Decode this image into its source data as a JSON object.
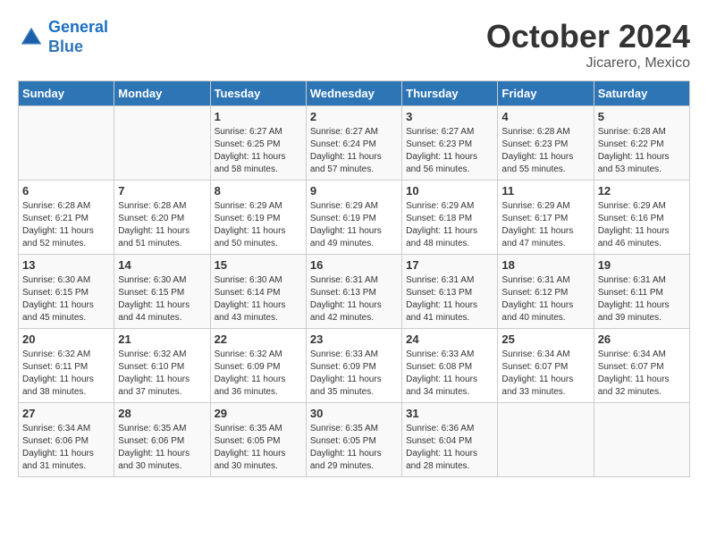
{
  "logo": {
    "line1": "General",
    "line2": "Blue"
  },
  "title": "October 2024",
  "subtitle": "Jicarero, Mexico",
  "headers": [
    "Sunday",
    "Monday",
    "Tuesday",
    "Wednesday",
    "Thursday",
    "Friday",
    "Saturday"
  ],
  "weeks": [
    [
      {
        "day": "",
        "info": ""
      },
      {
        "day": "",
        "info": ""
      },
      {
        "day": "1",
        "info": "Sunrise: 6:27 AM\nSunset: 6:25 PM\nDaylight: 11 hours and 58 minutes."
      },
      {
        "day": "2",
        "info": "Sunrise: 6:27 AM\nSunset: 6:24 PM\nDaylight: 11 hours and 57 minutes."
      },
      {
        "day": "3",
        "info": "Sunrise: 6:27 AM\nSunset: 6:23 PM\nDaylight: 11 hours and 56 minutes."
      },
      {
        "day": "4",
        "info": "Sunrise: 6:28 AM\nSunset: 6:23 PM\nDaylight: 11 hours and 55 minutes."
      },
      {
        "day": "5",
        "info": "Sunrise: 6:28 AM\nSunset: 6:22 PM\nDaylight: 11 hours and 53 minutes."
      }
    ],
    [
      {
        "day": "6",
        "info": "Sunrise: 6:28 AM\nSunset: 6:21 PM\nDaylight: 11 hours and 52 minutes."
      },
      {
        "day": "7",
        "info": "Sunrise: 6:28 AM\nSunset: 6:20 PM\nDaylight: 11 hours and 51 minutes."
      },
      {
        "day": "8",
        "info": "Sunrise: 6:29 AM\nSunset: 6:19 PM\nDaylight: 11 hours and 50 minutes."
      },
      {
        "day": "9",
        "info": "Sunrise: 6:29 AM\nSunset: 6:19 PM\nDaylight: 11 hours and 49 minutes."
      },
      {
        "day": "10",
        "info": "Sunrise: 6:29 AM\nSunset: 6:18 PM\nDaylight: 11 hours and 48 minutes."
      },
      {
        "day": "11",
        "info": "Sunrise: 6:29 AM\nSunset: 6:17 PM\nDaylight: 11 hours and 47 minutes."
      },
      {
        "day": "12",
        "info": "Sunrise: 6:29 AM\nSunset: 6:16 PM\nDaylight: 11 hours and 46 minutes."
      }
    ],
    [
      {
        "day": "13",
        "info": "Sunrise: 6:30 AM\nSunset: 6:15 PM\nDaylight: 11 hours and 45 minutes."
      },
      {
        "day": "14",
        "info": "Sunrise: 6:30 AM\nSunset: 6:15 PM\nDaylight: 11 hours and 44 minutes."
      },
      {
        "day": "15",
        "info": "Sunrise: 6:30 AM\nSunset: 6:14 PM\nDaylight: 11 hours and 43 minutes."
      },
      {
        "day": "16",
        "info": "Sunrise: 6:31 AM\nSunset: 6:13 PM\nDaylight: 11 hours and 42 minutes."
      },
      {
        "day": "17",
        "info": "Sunrise: 6:31 AM\nSunset: 6:13 PM\nDaylight: 11 hours and 41 minutes."
      },
      {
        "day": "18",
        "info": "Sunrise: 6:31 AM\nSunset: 6:12 PM\nDaylight: 11 hours and 40 minutes."
      },
      {
        "day": "19",
        "info": "Sunrise: 6:31 AM\nSunset: 6:11 PM\nDaylight: 11 hours and 39 minutes."
      }
    ],
    [
      {
        "day": "20",
        "info": "Sunrise: 6:32 AM\nSunset: 6:11 PM\nDaylight: 11 hours and 38 minutes."
      },
      {
        "day": "21",
        "info": "Sunrise: 6:32 AM\nSunset: 6:10 PM\nDaylight: 11 hours and 37 minutes."
      },
      {
        "day": "22",
        "info": "Sunrise: 6:32 AM\nSunset: 6:09 PM\nDaylight: 11 hours and 36 minutes."
      },
      {
        "day": "23",
        "info": "Sunrise: 6:33 AM\nSunset: 6:09 PM\nDaylight: 11 hours and 35 minutes."
      },
      {
        "day": "24",
        "info": "Sunrise: 6:33 AM\nSunset: 6:08 PM\nDaylight: 11 hours and 34 minutes."
      },
      {
        "day": "25",
        "info": "Sunrise: 6:34 AM\nSunset: 6:07 PM\nDaylight: 11 hours and 33 minutes."
      },
      {
        "day": "26",
        "info": "Sunrise: 6:34 AM\nSunset: 6:07 PM\nDaylight: 11 hours and 32 minutes."
      }
    ],
    [
      {
        "day": "27",
        "info": "Sunrise: 6:34 AM\nSunset: 6:06 PM\nDaylight: 11 hours and 31 minutes."
      },
      {
        "day": "28",
        "info": "Sunrise: 6:35 AM\nSunset: 6:06 PM\nDaylight: 11 hours and 30 minutes."
      },
      {
        "day": "29",
        "info": "Sunrise: 6:35 AM\nSunset: 6:05 PM\nDaylight: 11 hours and 30 minutes."
      },
      {
        "day": "30",
        "info": "Sunrise: 6:35 AM\nSunset: 6:05 PM\nDaylight: 11 hours and 29 minutes."
      },
      {
        "day": "31",
        "info": "Sunrise: 6:36 AM\nSunset: 6:04 PM\nDaylight: 11 hours and 28 minutes."
      },
      {
        "day": "",
        "info": ""
      },
      {
        "day": "",
        "info": ""
      }
    ]
  ]
}
